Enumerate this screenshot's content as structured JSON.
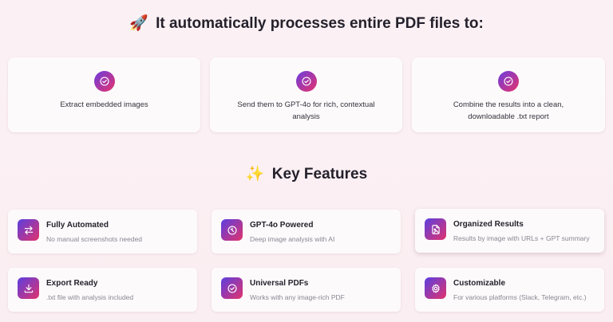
{
  "process": {
    "icon": "🚀",
    "title": "It automatically processes entire PDF files to:",
    "steps": [
      {
        "text": "Extract embedded images",
        "icon": "check-circle-icon"
      },
      {
        "text": "Send them to GPT-4o for rich, contextual analysis",
        "icon": "check-circle-icon"
      },
      {
        "text": "Combine the results into a clean, downloadable .txt report",
        "icon": "check-circle-icon"
      }
    ]
  },
  "features": {
    "icon": "✨",
    "title": "Key Features",
    "items": [
      {
        "title": "Fully Automated",
        "desc": "No manual screenshots needed",
        "icon": "swap-arrows-icon"
      },
      {
        "title": "GPT-4o Powered",
        "desc": "Deep image analysis with AI",
        "icon": "ai-chip-icon"
      },
      {
        "title": "Organized Results",
        "desc": "Results by image with URLs + GPT summary",
        "icon": "image-file-icon"
      },
      {
        "title": "Export Ready",
        "desc": ".txt file with analysis included",
        "icon": "download-icon"
      },
      {
        "title": "Universal PDFs",
        "desc": "Works with any image-rich PDF",
        "icon": "check-circle-icon"
      },
      {
        "title": "Customizable",
        "desc": "For various platforms (Slack, Telegram, etc.)",
        "icon": "gear-icon"
      }
    ]
  },
  "colors": {
    "background": "#fbf1f4",
    "accent_start": "#6a3ce0",
    "accent_end": "#e8336c"
  }
}
